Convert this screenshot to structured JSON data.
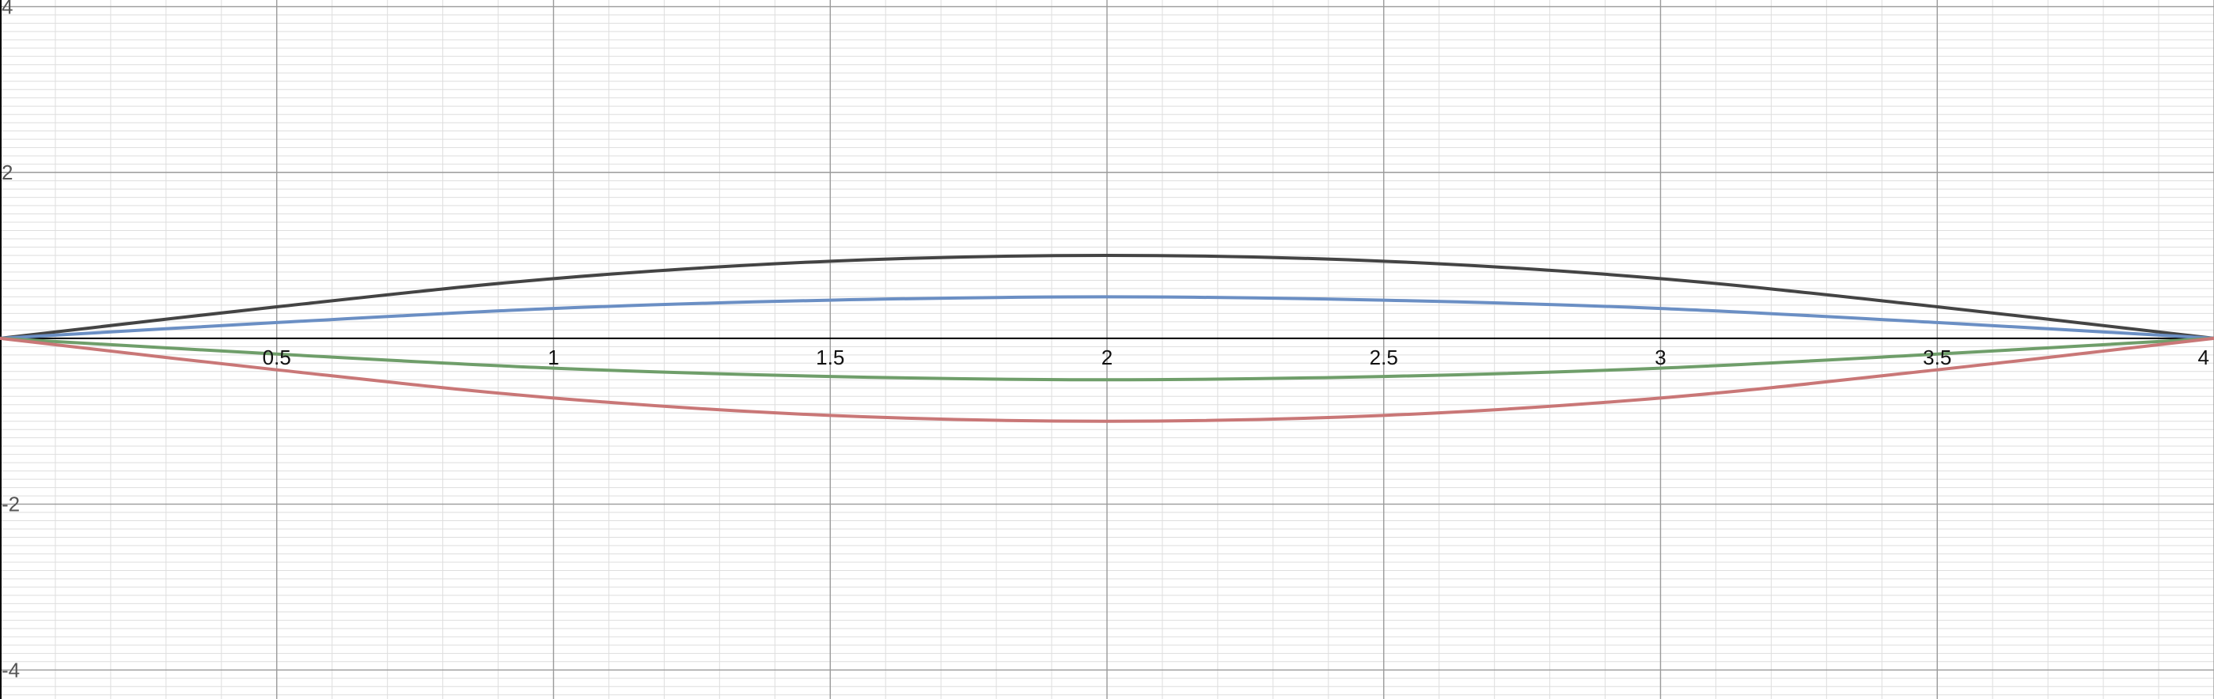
{
  "chart_data": {
    "type": "line",
    "title": "",
    "xlabel": "",
    "ylabel": "",
    "xlim": [
      0,
      4
    ],
    "ylim": [
      -4.35,
      4.08
    ],
    "grid": true,
    "minor_grid_step": 0.1,
    "major_grid_step_x": 0.5,
    "major_grid_step_y": 2,
    "x_tick_labels": [
      {
        "value": 0.5,
        "text": "0.5"
      },
      {
        "value": 1,
        "text": "1"
      },
      {
        "value": 1.5,
        "text": "1.5"
      },
      {
        "value": 2,
        "text": "2"
      },
      {
        "value": 2.5,
        "text": "2.5"
      },
      {
        "value": 3,
        "text": "3"
      },
      {
        "value": 3.5,
        "text": "3.5"
      },
      {
        "value": 4,
        "text": "4"
      }
    ],
    "y_tick_labels": [
      {
        "value": 4,
        "text": "4"
      },
      {
        "value": 2,
        "text": "2"
      },
      {
        "value": -2,
        "text": "-2"
      },
      {
        "value": -4,
        "text": "-4"
      }
    ],
    "colors": {
      "axis": "#000000",
      "major_grid": "#9a9a9a",
      "minor_grid": "#dedede"
    },
    "series": [
      {
        "color": "#444444",
        "x": [
          0,
          0.5,
          1,
          1.5,
          2,
          2.5,
          3,
          3.5,
          4
        ],
        "y": [
          0,
          0.38,
          0.72,
          0.93,
          1.0,
          0.93,
          0.72,
          0.38,
          0
        ]
      },
      {
        "color": "#6b8fc4",
        "x": [
          0,
          0.5,
          1,
          1.5,
          2,
          2.5,
          3,
          3.5,
          4
        ],
        "y": [
          0,
          0.19,
          0.36,
          0.46,
          0.5,
          0.46,
          0.36,
          0.19,
          0
        ]
      },
      {
        "color": "#6f9e6a",
        "x": [
          0,
          0.5,
          1,
          1.5,
          2,
          2.5,
          3,
          3.5,
          4
        ],
        "y": [
          0,
          -0.19,
          -0.36,
          -0.46,
          -0.5,
          -0.46,
          -0.36,
          -0.19,
          0
        ]
      },
      {
        "color": "#c97777",
        "x": [
          0,
          0.5,
          1,
          1.5,
          2,
          2.5,
          3,
          3.5,
          4
        ],
        "y": [
          0,
          -0.38,
          -0.72,
          -0.93,
          -1.0,
          -0.93,
          -0.72,
          -0.38,
          0
        ]
      }
    ]
  }
}
